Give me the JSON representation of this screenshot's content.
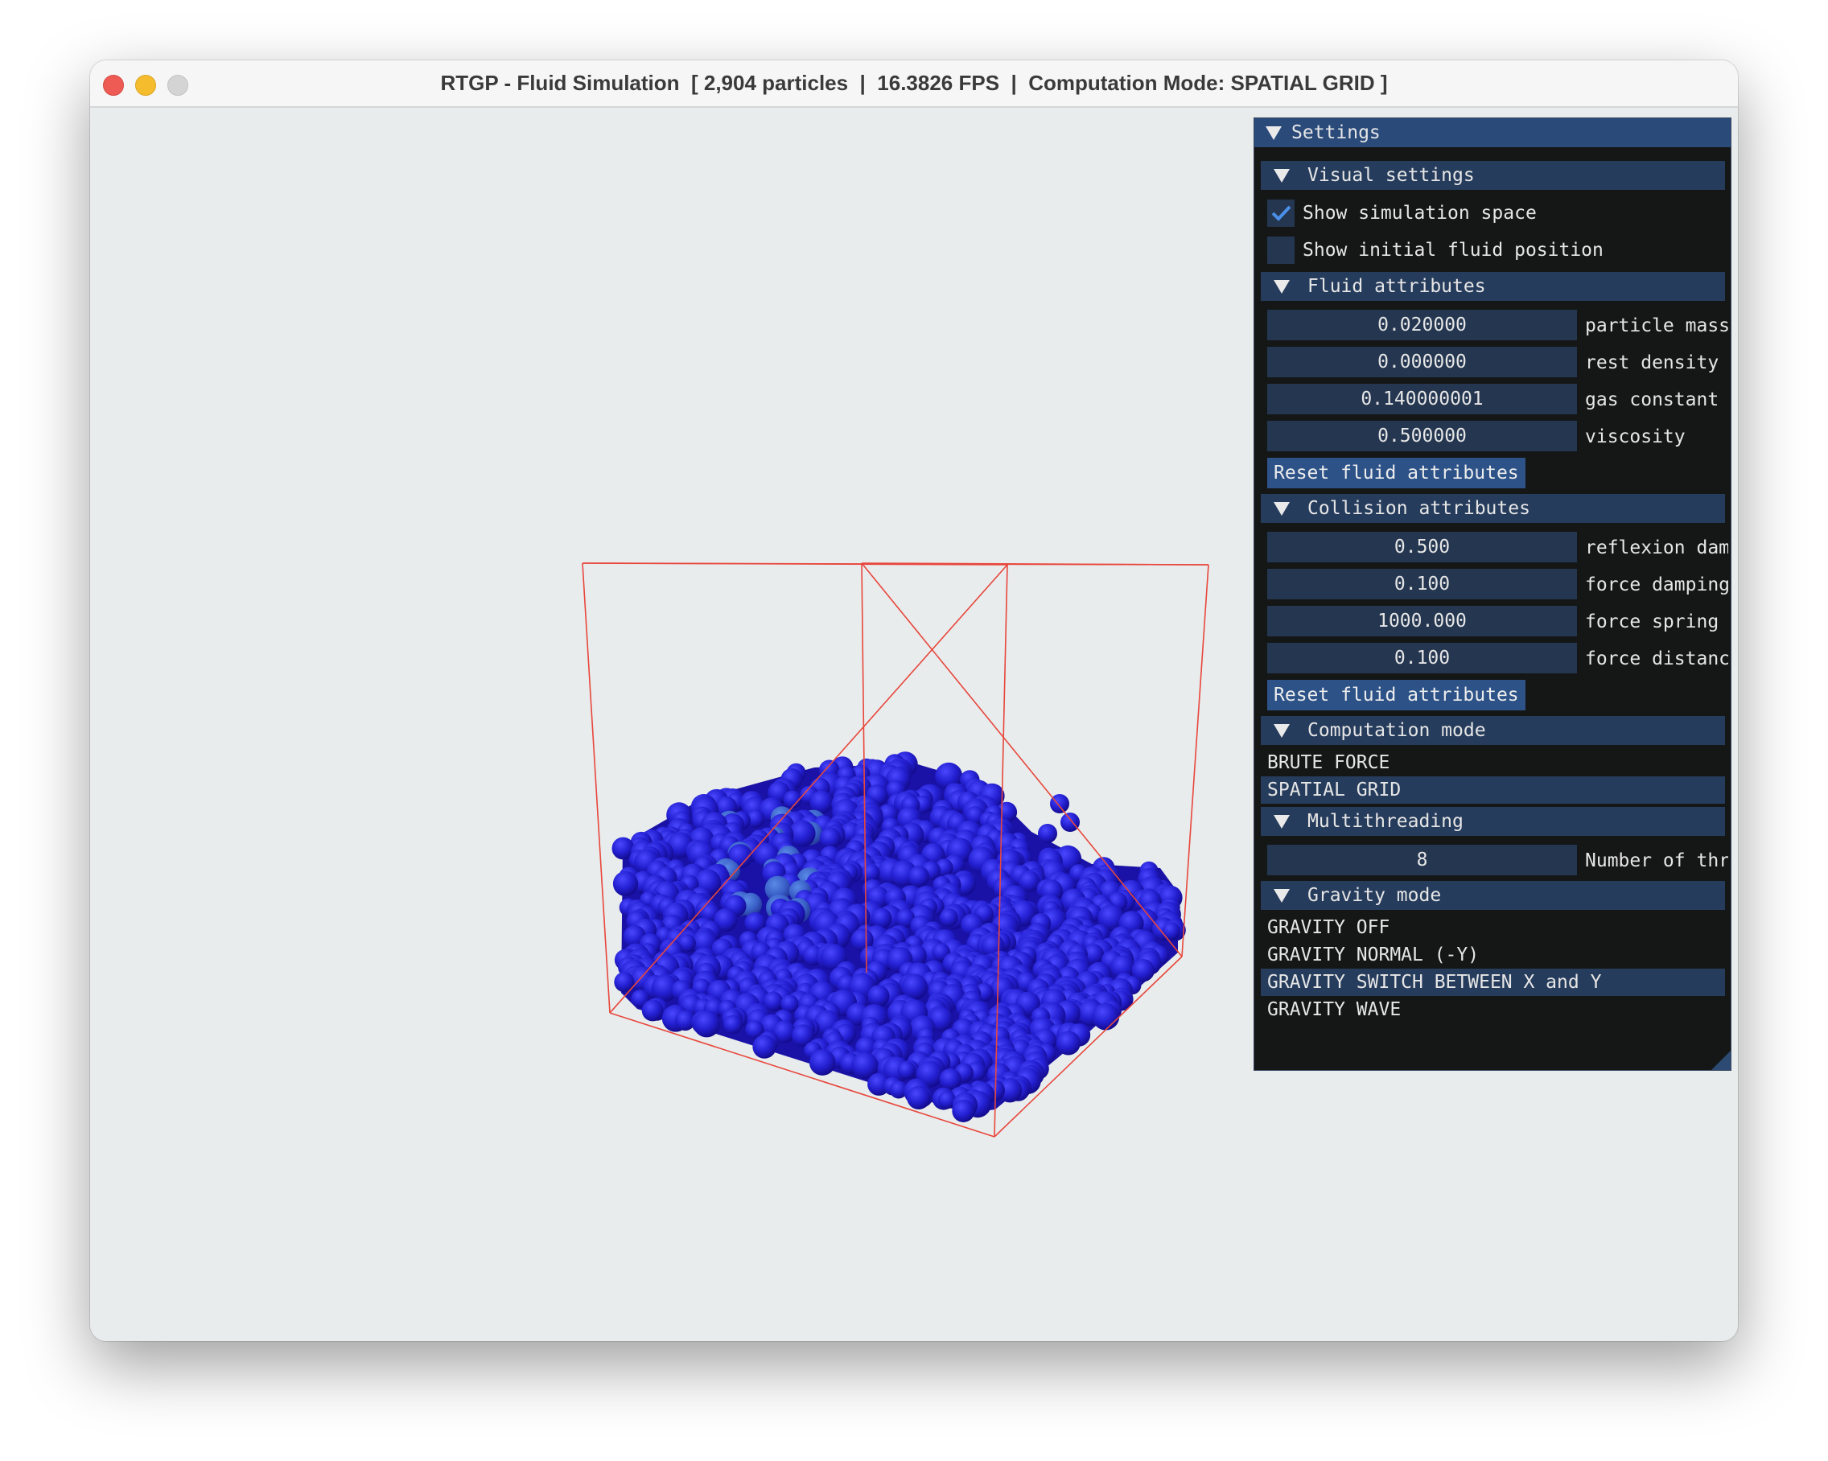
{
  "window": {
    "title": "RTGP - Fluid Simulation  [ 2,904 particles  |  16.3826 FPS  |  Computation Mode: SPATIAL GRID ]"
  },
  "settings": {
    "title": "Settings",
    "visual": {
      "header": "Visual settings",
      "show_simulation_space": {
        "label": "Show simulation space",
        "checked": true
      },
      "show_initial_fluid": {
        "label": "Show initial fluid position",
        "checked": false
      }
    },
    "fluid": {
      "header": "Fluid attributes",
      "fields": [
        {
          "value": "0.020000",
          "label": "particle mass"
        },
        {
          "value": "0.000000",
          "label": "rest density"
        },
        {
          "value": "0.140000001",
          "label": "gas constant"
        },
        {
          "value": "0.500000",
          "label": "viscosity"
        }
      ],
      "reset": "Reset fluid attributes"
    },
    "collision": {
      "header": "Collision attributes",
      "fields": [
        {
          "value": "0.500",
          "label": "reflexion damping"
        },
        {
          "value": "0.100",
          "label": "force damping"
        },
        {
          "value": "1000.000",
          "label": "force spring"
        },
        {
          "value": "0.100",
          "label": "force distance"
        }
      ],
      "reset": "Reset fluid attributes"
    },
    "computation": {
      "header": "Computation mode",
      "options": [
        "BRUTE FORCE",
        "SPATIAL GRID"
      ],
      "selected": "SPATIAL GRID"
    },
    "multithreading": {
      "header": "Multithreading",
      "threads": {
        "value": "8",
        "label": "Number of threads"
      }
    },
    "gravity": {
      "header": "Gravity mode",
      "options": [
        "GRAVITY OFF",
        "GRAVITY NORMAL (-Y)",
        "GRAVITY SWITCH BETWEEN X and Y",
        "GRAVITY WAVE"
      ],
      "selected": "GRAVITY SWITCH BETWEEN X and Y"
    }
  },
  "colors": {
    "box_lines": "#e8463c",
    "particle_dark": "#1a10a8",
    "particle_mid": "#2828d8",
    "particle_light": "#3a64c8",
    "viewport_bg": "#e8ecec"
  }
}
